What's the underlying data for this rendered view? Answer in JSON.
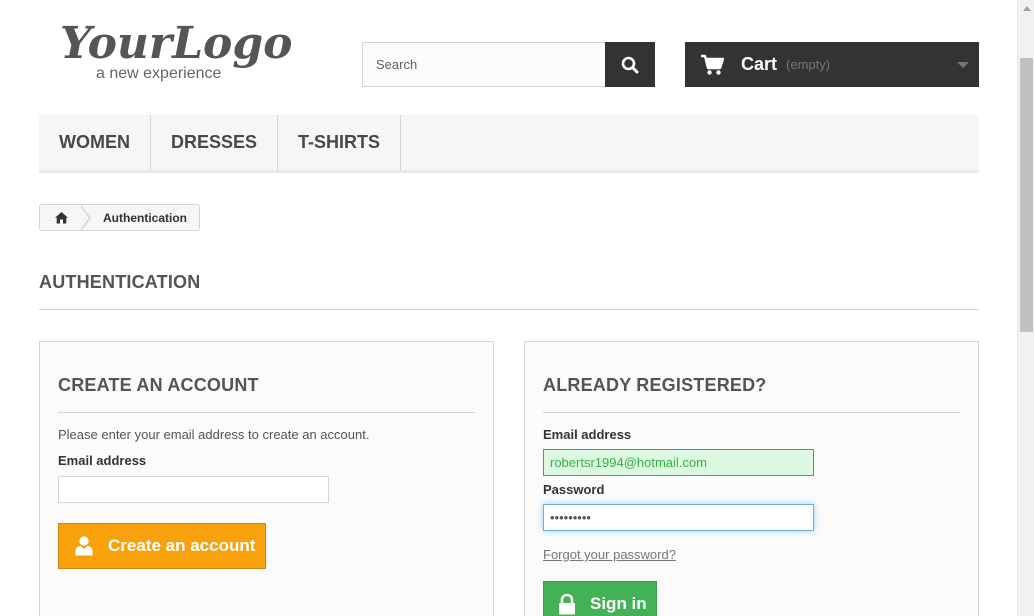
{
  "logo": {
    "main": "YourLogo",
    "tagline": "a new experience"
  },
  "search": {
    "placeholder": "Search",
    "value": ""
  },
  "cart": {
    "label": "Cart",
    "status": "(empty)"
  },
  "menu": {
    "items": [
      "WOMEN",
      "DRESSES",
      "T-SHIRTS"
    ]
  },
  "breadcrumb": {
    "current": "Authentication"
  },
  "page": {
    "heading": "AUTHENTICATION"
  },
  "create_account": {
    "title": "CREATE AN ACCOUNT",
    "description": "Please enter your email address to create an account.",
    "email_label": "Email address",
    "email_value": "",
    "button_label": "Create an account"
  },
  "login": {
    "title": "ALREADY REGISTERED?",
    "email_label": "Email address",
    "email_value": "robertsr1994@hotmail.com",
    "password_label": "Password",
    "password_value": "•••••••••",
    "forgot_label": "Forgot your password?",
    "button_label": "Sign in"
  },
  "colors": {
    "dark": "#333333",
    "create_button": "#f7a20c",
    "signin_button": "#43b155",
    "valid_field_bg": "#ddf9e1"
  },
  "icons": [
    "search-icon",
    "cart-icon",
    "home-icon",
    "user-icon",
    "lock-icon",
    "chevron-down-icon"
  ]
}
